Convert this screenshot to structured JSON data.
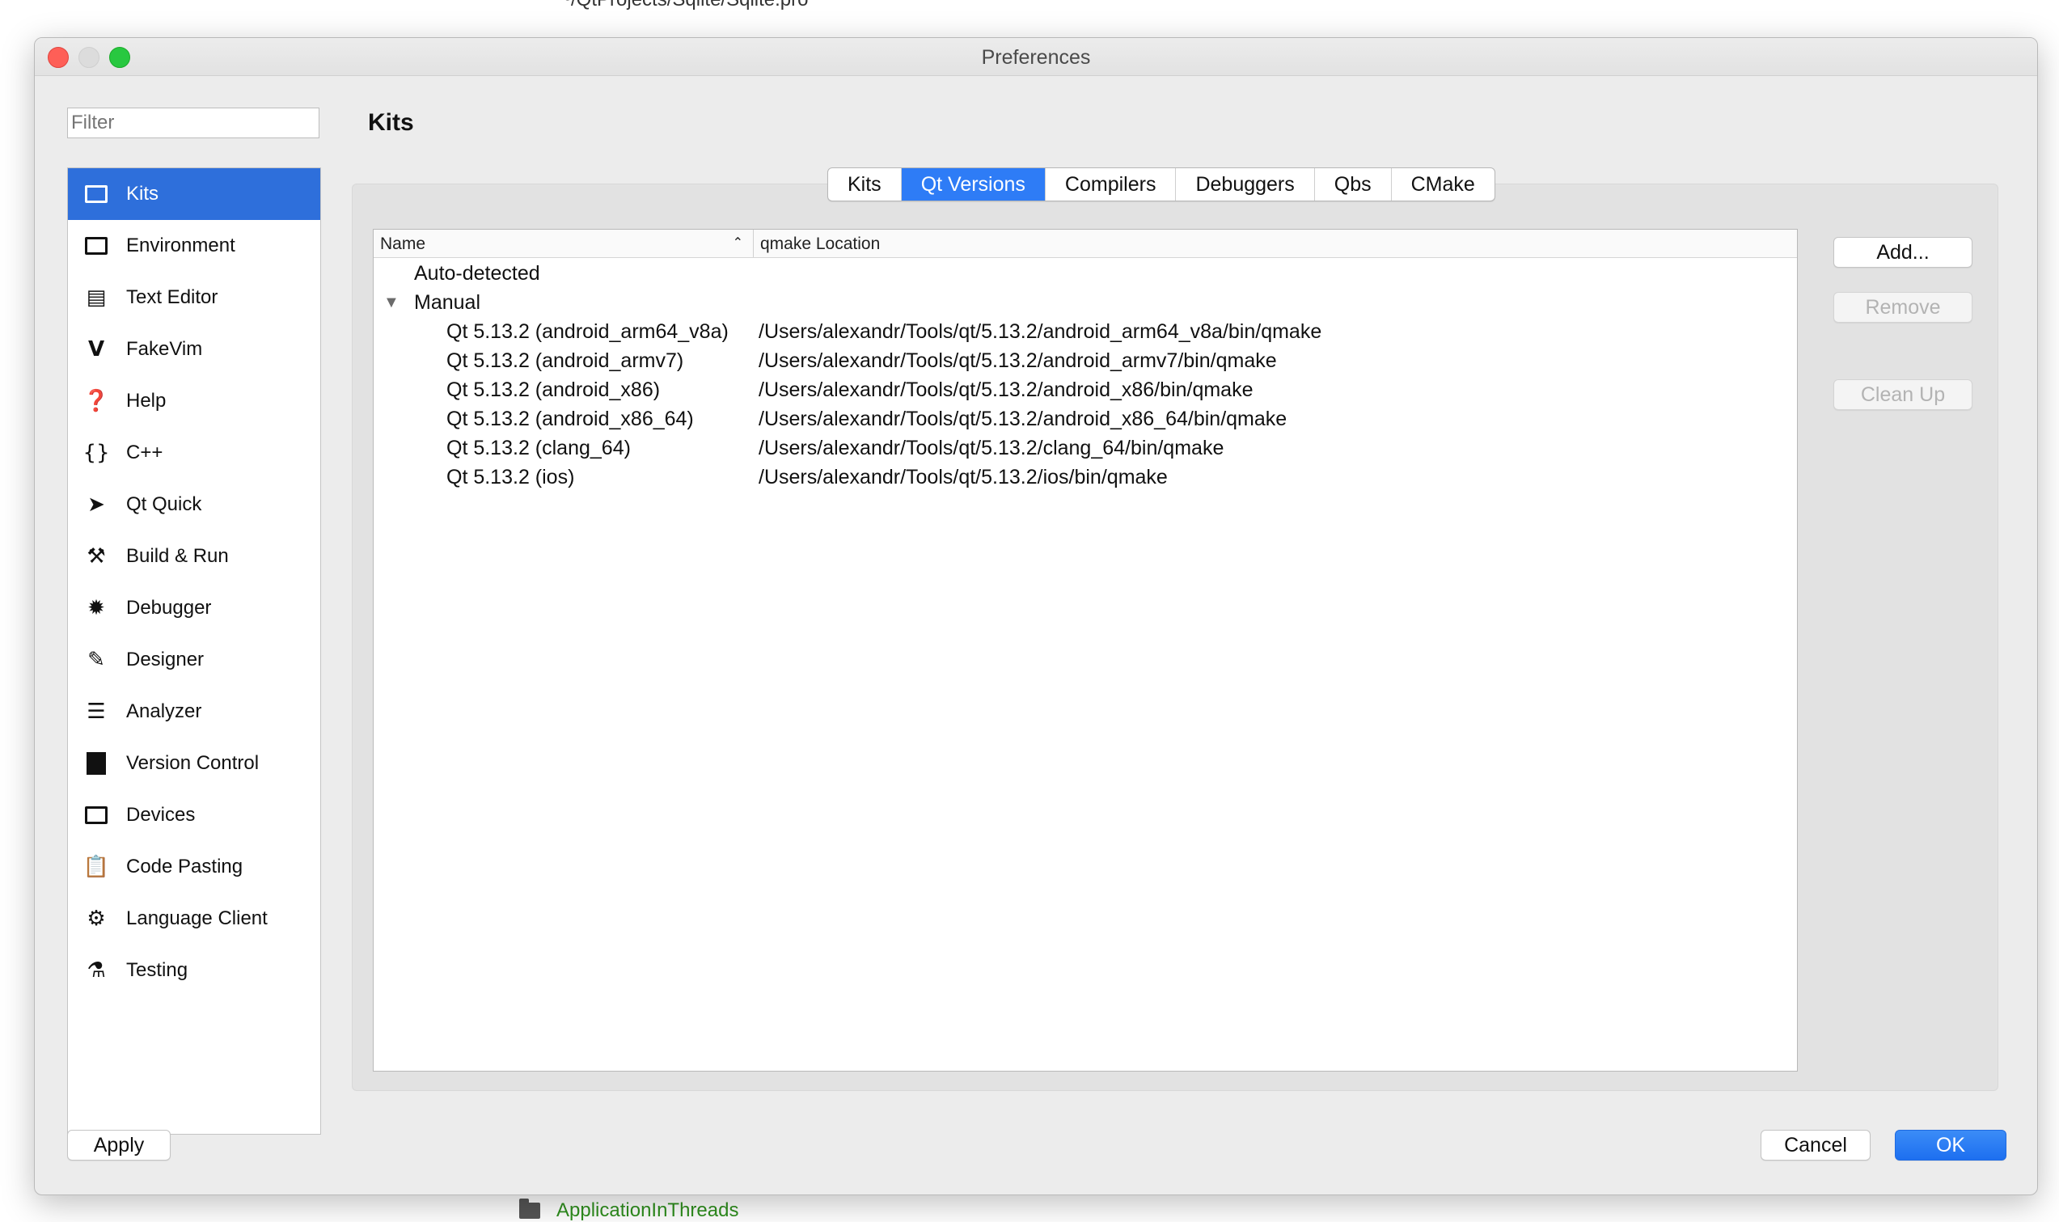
{
  "background": {
    "path_text": "~/QtProjects/Sqlite/Sqlite.pro",
    "project_item": "ApplicationInThreads"
  },
  "window": {
    "title": "Preferences"
  },
  "filter": {
    "placeholder": "Filter"
  },
  "sidebar": {
    "items": [
      {
        "label": "Kits",
        "icon": "kits-icon",
        "active": true
      },
      {
        "label": "Environment",
        "icon": "monitor-icon"
      },
      {
        "label": "Text Editor",
        "icon": "text-editor-icon"
      },
      {
        "label": "FakeVim",
        "icon": "fakevim-icon"
      },
      {
        "label": "Help",
        "icon": "help-icon"
      },
      {
        "label": "C++",
        "icon": "braces-icon"
      },
      {
        "label": "Qt Quick",
        "icon": "paper-plane-icon"
      },
      {
        "label": "Build & Run",
        "icon": "hammer-icon"
      },
      {
        "label": "Debugger",
        "icon": "bug-icon"
      },
      {
        "label": "Designer",
        "icon": "pencil-icon"
      },
      {
        "label": "Analyzer",
        "icon": "analyzer-icon"
      },
      {
        "label": "Version Control",
        "icon": "version-control-icon"
      },
      {
        "label": "Devices",
        "icon": "devices-icon"
      },
      {
        "label": "Code Pasting",
        "icon": "clipboard-icon"
      },
      {
        "label": "Language Client",
        "icon": "language-client-icon"
      },
      {
        "label": "Testing",
        "icon": "flask-icon"
      }
    ]
  },
  "main": {
    "title": "Kits",
    "tabs": [
      {
        "label": "Kits"
      },
      {
        "label": "Qt Versions",
        "active": true
      },
      {
        "label": "Compilers"
      },
      {
        "label": "Debuggers"
      },
      {
        "label": "Qbs"
      },
      {
        "label": "CMake"
      }
    ],
    "table": {
      "columns": [
        "Name",
        "qmake Location"
      ],
      "groups": [
        {
          "label": "Auto-detected",
          "expanded": false
        },
        {
          "label": "Manual",
          "expanded": true
        }
      ],
      "rows": [
        {
          "name": "Qt 5.13.2 (android_arm64_v8a)",
          "location": "/Users/alexandr/Tools/qt/5.13.2/android_arm64_v8a/bin/qmake"
        },
        {
          "name": "Qt 5.13.2 (android_armv7)",
          "location": "/Users/alexandr/Tools/qt/5.13.2/android_armv7/bin/qmake"
        },
        {
          "name": "Qt 5.13.2 (android_x86)",
          "location": "/Users/alexandr/Tools/qt/5.13.2/android_x86/bin/qmake"
        },
        {
          "name": "Qt 5.13.2 (android_x86_64)",
          "location": "/Users/alexandr/Tools/qt/5.13.2/android_x86_64/bin/qmake"
        },
        {
          "name": "Qt 5.13.2 (clang_64)",
          "location": "/Users/alexandr/Tools/qt/5.13.2/clang_64/bin/qmake"
        },
        {
          "name": "Qt 5.13.2 (ios)",
          "location": "/Users/alexandr/Tools/qt/5.13.2/ios/bin/qmake"
        }
      ]
    },
    "buttons": {
      "add": "Add...",
      "remove": "Remove",
      "clean_up": "Clean Up"
    }
  },
  "footer": {
    "apply": "Apply",
    "cancel": "Cancel",
    "ok": "OK"
  },
  "colors": {
    "accent": "#2e7cf6",
    "sidebar_active": "#2e6fdb"
  }
}
